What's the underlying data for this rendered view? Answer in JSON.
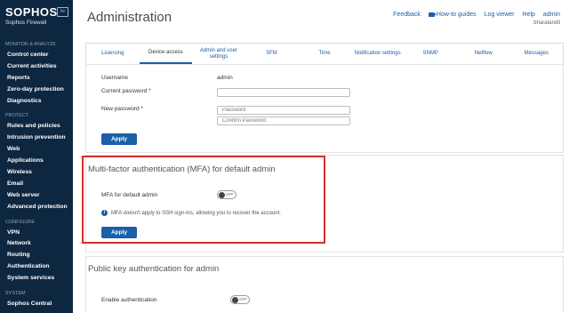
{
  "brand": {
    "name": "SOPHOS",
    "badge": "fw",
    "subtitle": "Sophos Firewall"
  },
  "sidebar": {
    "sections": [
      {
        "title": "MONITOR & ANALYZE",
        "items": [
          "Control center",
          "Current activities",
          "Reports",
          "Zero-day protection",
          "Diagnostics"
        ]
      },
      {
        "title": "PROTECT",
        "items": [
          "Rules and policies",
          "Intrusion prevention",
          "Web",
          "Applications",
          "Wireless",
          "Email",
          "Web server",
          "Advanced protection"
        ]
      },
      {
        "title": "CONFIGURE",
        "items": [
          "VPN",
          "Network",
          "Routing",
          "Authentication",
          "System services"
        ]
      },
      {
        "title": "SYSTEM",
        "items": [
          "Sophos Central"
        ]
      }
    ]
  },
  "header": {
    "title": "Administration",
    "links": {
      "feedback": "Feedback",
      "howto": "How-to guides",
      "logviewer": "Log viewer",
      "help": "Help",
      "user": "admin"
    },
    "user_sub": "bharatandli"
  },
  "tabs": [
    "Licensing",
    "Device access",
    "Admin and user settings",
    "SFM",
    "Time",
    "Notification settings",
    "SNMP",
    "Netflow",
    "Messages"
  ],
  "active_tab": "Device access",
  "password_form": {
    "username_label": "Username",
    "username_value": "admin",
    "current_password_label": "Current password *",
    "new_password_label": "New password *",
    "password_placeholder": "Password",
    "confirm_placeholder": "Confirm Password",
    "apply_label": "Apply"
  },
  "mfa": {
    "title": "Multi-factor authentication (MFA) for default admin",
    "toggle_label": "MFA for default admin",
    "toggle_state": "OFF",
    "info_text": "MFA doesn't apply to SSH sign-ins, allowing you to recover the account.",
    "apply_label": "Apply"
  },
  "pubkey": {
    "title": "Public key authentication for admin",
    "toggle_label": "Enable authentication",
    "toggle_state": "OFF"
  },
  "colors": {
    "sidebar_bg": "#0e2740",
    "accent": "#1a5fa8",
    "highlight": "#d32f2f"
  }
}
